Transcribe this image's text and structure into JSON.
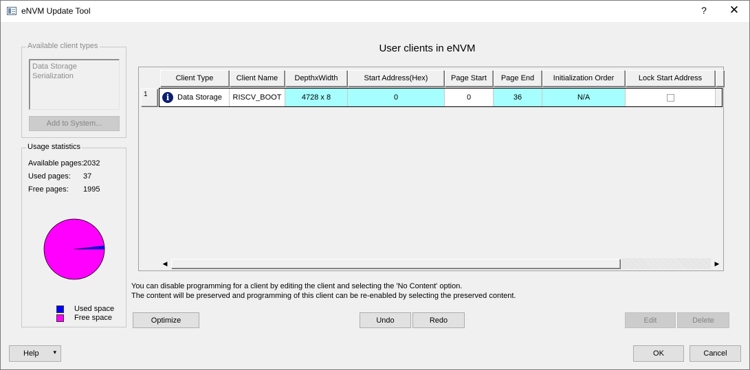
{
  "window": {
    "title": "eNVM Update Tool",
    "help_glyph": "?",
    "close_glyph": "✕"
  },
  "available_client_types": {
    "legend": "Available client types",
    "items": [
      "Data Storage",
      "Serialization"
    ],
    "add_button": "Add to System..."
  },
  "usage_statistics": {
    "legend": "Usage statistics",
    "available_label": "Available pages:",
    "available_value": "2032",
    "used_label": "Used pages:",
    "used_value": "37",
    "free_label": "Free pages:",
    "free_value": "1995",
    "chart_data": {
      "type": "pie",
      "labels": [
        "Used space",
        "Free space"
      ],
      "values": [
        37,
        1995
      ],
      "colors": [
        "#0000ff",
        "#ff00ff"
      ]
    },
    "legend_used": "Used space",
    "legend_free": "Free space"
  },
  "main": {
    "heading": "User clients in eNVM",
    "columns": [
      "Client Type",
      "Client Name",
      "DepthxWidth",
      "Start Address(Hex)",
      "Page Start",
      "Page End",
      "Initialization Order",
      "Lock Start Address"
    ],
    "rows": [
      {
        "row_number": "1",
        "client_type": "Data Storage",
        "client_name": "RISCV_BOOT",
        "depth_width": "4728 x 8",
        "start_address": "0",
        "page_start": "0",
        "page_end": "36",
        "init_order": "N/A",
        "lock_start_address": false,
        "icon": "info-icon"
      }
    ],
    "info_line_1": "You can disable programming for a client by editing the client and selecting the 'No Content' option.",
    "info_line_2": "The content will be preserved and programming of this client can be re-enabled by selecting the preserved content."
  },
  "buttons": {
    "optimize": "Optimize",
    "undo": "Undo",
    "redo": "Redo",
    "edit": "Edit",
    "delete": "Delete",
    "help": "Help",
    "help_arrow": "▾",
    "ok": "OK",
    "cancel": "Cancel"
  },
  "colors": {
    "cyan_cell": "#a6fefe",
    "used_space": "#0000ff",
    "free_space": "#ff00ff"
  }
}
